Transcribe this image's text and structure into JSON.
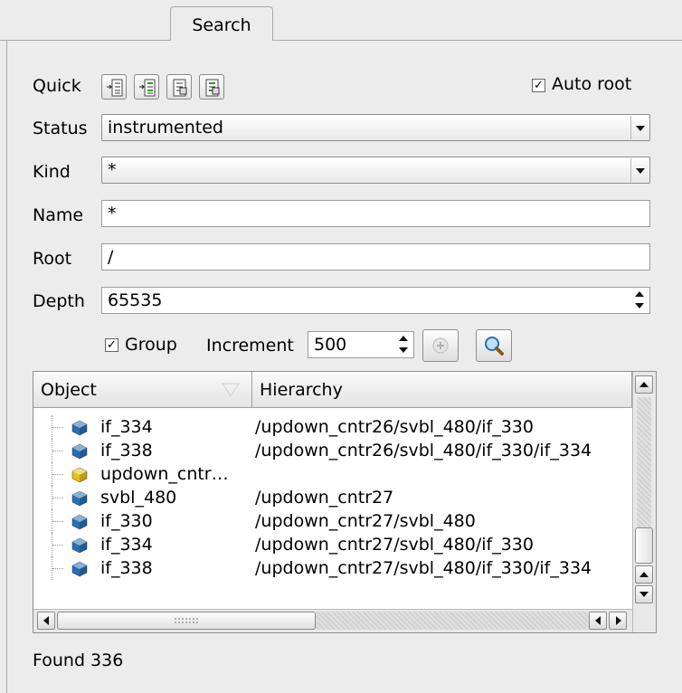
{
  "tab": {
    "label": "Search"
  },
  "quick": {
    "label": "Quick",
    "buttons": [
      "expand-all-icon",
      "expand-selected-icon",
      "collapse-all-icon",
      "collapse-selected-icon"
    ]
  },
  "auto_root": {
    "label": "Auto root",
    "checked": true
  },
  "status": {
    "label": "Status",
    "value": "instrumented"
  },
  "kind": {
    "label": "Kind",
    "value": "*"
  },
  "name": {
    "label": "Name",
    "value": "*"
  },
  "root": {
    "label": "Root",
    "value": "/"
  },
  "depth": {
    "label": "Depth",
    "value": "65535"
  },
  "group": {
    "label": "Group",
    "checked": true
  },
  "increment": {
    "label": "Increment",
    "value": "500"
  },
  "table": {
    "columns": [
      "Object",
      "Hierarchy"
    ],
    "rows": [
      {
        "object": "if_334",
        "hierarchy": "/updown_cntr26/svbl_480/if_330",
        "icon": "blue-cube-icon"
      },
      {
        "object": "if_338",
        "hierarchy": "/updown_cntr26/svbl_480/if_330/if_334",
        "icon": "blue-cube-icon"
      },
      {
        "object": "updown_cntr…",
        "hierarchy": "",
        "icon": "yellow-cube-icon"
      },
      {
        "object": "svbl_480",
        "hierarchy": "/updown_cntr27",
        "icon": "blue-cube-icon"
      },
      {
        "object": "if_330",
        "hierarchy": "/updown_cntr27/svbl_480",
        "icon": "blue-cube-icon"
      },
      {
        "object": "if_334",
        "hierarchy": "/updown_cntr27/svbl_480/if_330",
        "icon": "blue-cube-icon"
      },
      {
        "object": "if_338",
        "hierarchy": "/updown_cntr27/svbl_480/if_330/if_334",
        "icon": "blue-cube-icon"
      }
    ]
  },
  "status_text": "Found 336",
  "colors": {
    "blue_cube": "#2a6fb5",
    "yellow_cube": "#e8c21a",
    "panel_bg": "#ececec"
  }
}
